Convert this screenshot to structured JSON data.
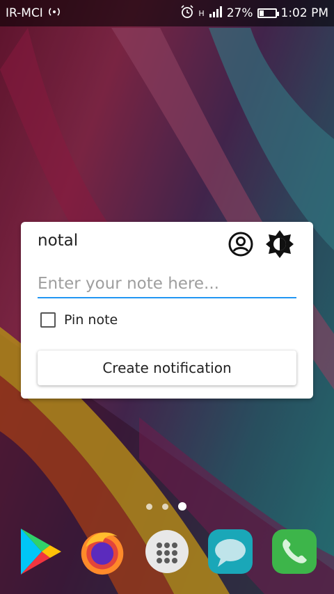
{
  "status_bar": {
    "carrier": "IR-MCI",
    "network_type": "H",
    "battery_percent": "27%",
    "battery_level": 0.27,
    "time": "1:02 PM"
  },
  "widget": {
    "app_title": "notal",
    "note_placeholder": "Enter your note here...",
    "pin_label": "Pin note",
    "pin_checked": false,
    "create_button_label": "Create notification",
    "accent_color": "#2196f3"
  },
  "home_screen": {
    "page_count": 3,
    "active_page": 3
  },
  "dock": {
    "apps": [
      {
        "name": "play-store-icon"
      },
      {
        "name": "firefox-icon"
      },
      {
        "name": "app-drawer-icon"
      },
      {
        "name": "messages-icon"
      },
      {
        "name": "phone-icon"
      }
    ]
  }
}
